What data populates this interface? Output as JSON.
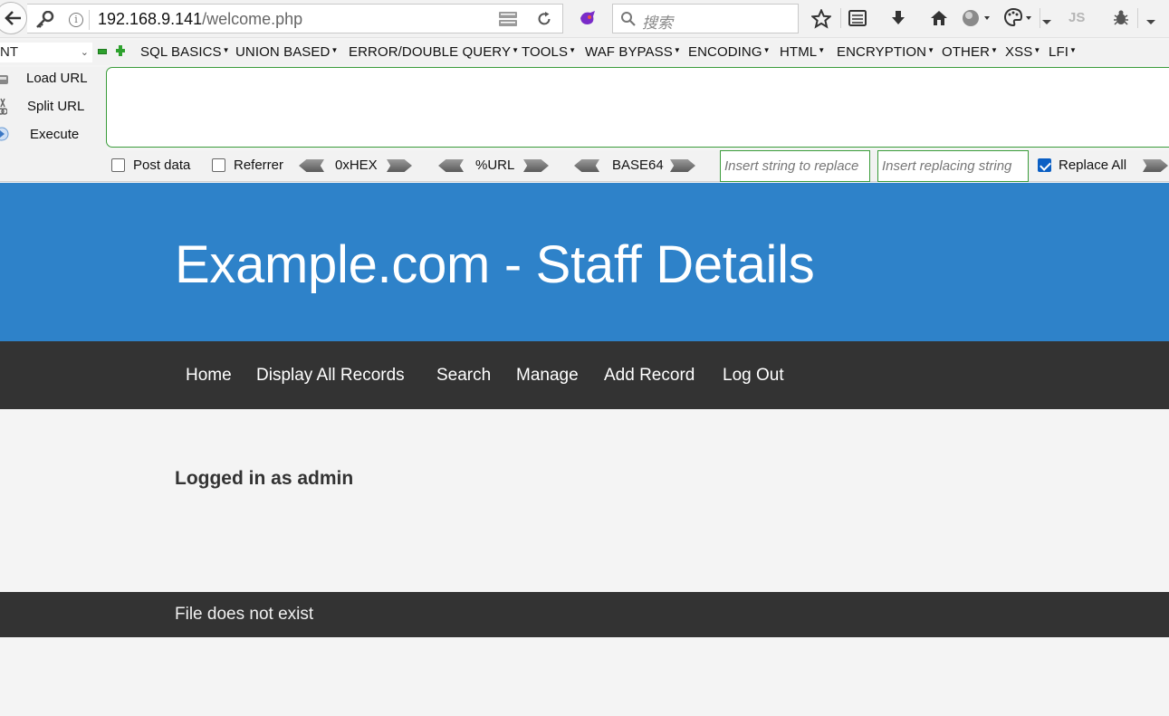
{
  "browser": {
    "url_host": "192.168.9.141",
    "url_path": "/welcome.php",
    "search_placeholder": "搜索",
    "toolbar_text": "JS"
  },
  "hackbar": {
    "method_select": "NT",
    "menus": [
      "SQL BASICS",
      "UNION BASED",
      "ERROR/DOUBLE QUERY",
      "TOOLS",
      "WAF BYPASS",
      "ENCODING",
      "HTML",
      "ENCRYPTION",
      "OTHER",
      "XSS",
      "LFI"
    ],
    "load_url": "Load URL",
    "split_url": "Split URL",
    "execute": "Execute",
    "post_data": "Post data",
    "referrer": "Referrer",
    "hex": "0xHEX",
    "url_enc": "%URL",
    "base64": "BASE64",
    "replace_placeholder": "Insert string to replace",
    "replacing_placeholder": "Insert replacing string",
    "replace_all": "Replace All"
  },
  "site": {
    "title": "Example.com - Staff Details",
    "nav": [
      "Home",
      "Display All Records",
      "Search",
      "Manage",
      "Add Record",
      "Log Out"
    ],
    "logged_in": "Logged in as admin",
    "footer": "File does not exist"
  },
  "colors": {
    "hero": "#2e82c9",
    "nav": "#333333",
    "accent_border": "#3a9c3a"
  }
}
